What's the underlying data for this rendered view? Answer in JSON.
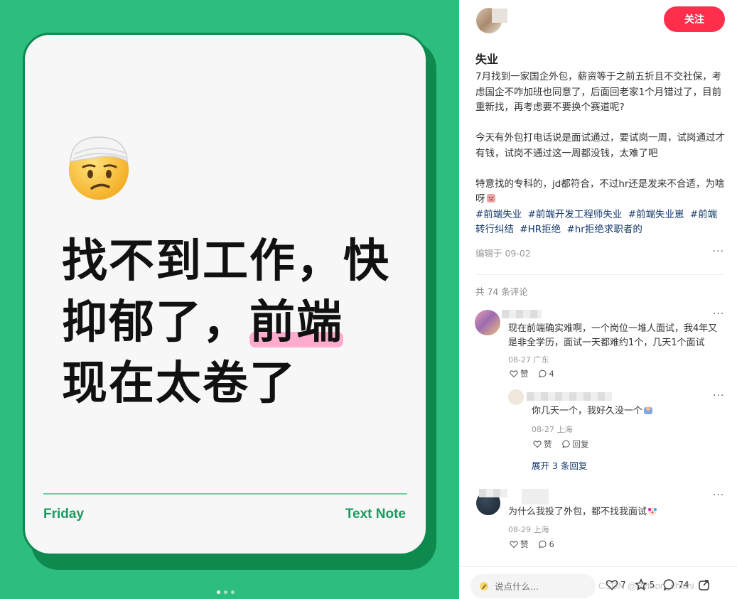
{
  "image_card": {
    "headline_line1": "找不到工作，快",
    "headline_line2_a": "抑郁了，",
    "headline_line2_highlight": "前端",
    "headline_line3": "现在太卷了",
    "footer_left": "Friday",
    "footer_right": "Text Note",
    "emoji_icon": "bandaged-head-face-icon",
    "highlight_color": "#ff9fc5",
    "background_color": "#2dbd7e"
  },
  "note": {
    "follow_label": "关注",
    "title": "失业",
    "paragraphs": [
      "7月找到一家国企外包，薪资等于之前五折且不交社保，考虑国企不咋加班也同意了，后面回老家1个月错过了，目前重新找，再考虑要不要换个赛道呢?",
      "今天有外包打电话说是面试通过，要试岗一周，试岗通过才有钱，试岗不通过这一周都没钱，太难了吧",
      "特意找的专科的，jd都符合，不过hr还是发来不合适，为啥呀"
    ],
    "tags": [
      "#前端失业",
      "#前端开发工程师失业",
      "#前端失业崽",
      "#前端转行纠结",
      "#HR拒绝",
      "#hr拒绝求职者的"
    ],
    "edited": "编辑于 09-02",
    "more": "···",
    "comment_count": "共 74 条评论"
  },
  "comments": [
    {
      "text": "现在前端确实难啊，一个岗位一堆人面试，我4年又是非全学历，面试一天都难约1个，几天1个面试",
      "meta": "08-27 广东",
      "like": "赞",
      "reply_count": "4",
      "more": "···"
    },
    {
      "text": "你几天一个，我好久没一个",
      "meta": "08-27 上海",
      "like": "赞",
      "reply": "回复",
      "more": "···",
      "expand": "展开 3 条回复"
    },
    {
      "text": "为什么我投了外包，都不找我面试",
      "meta": "08-29 上海",
      "like": "赞",
      "reply_count": "6",
      "more": "···"
    }
  ],
  "bottom_bar": {
    "placeholder": "说点什么...",
    "likes": "7",
    "collects": "5",
    "comments": "74",
    "watermark": "CSDN @Python_chichi"
  },
  "colors": {
    "accent": "#ff2e4d",
    "tag": "#13386c"
  }
}
